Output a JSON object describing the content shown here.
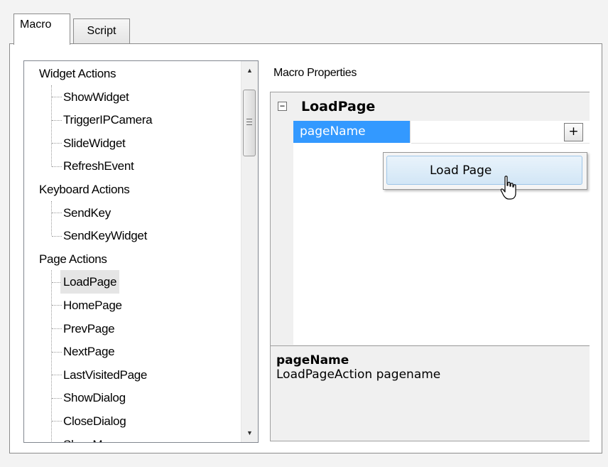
{
  "tabs": [
    {
      "label": "Macro",
      "active": true
    },
    {
      "label": "Script",
      "active": false
    }
  ],
  "action_tree": {
    "categories": [
      {
        "label": "Widget Actions",
        "children": [
          "ShowWidget",
          "TriggerIPCamera",
          "SlideWidget",
          "RefreshEvent"
        ]
      },
      {
        "label": "Keyboard Actions",
        "children": [
          "SendKey",
          "SendKeyWidget"
        ]
      },
      {
        "label": "Page Actions",
        "children": [
          "LoadPage",
          "HomePage",
          "PrevPage",
          "NextPage",
          "LastVisitedPage",
          "ShowDialog",
          "CloseDialog",
          "ShowMessage"
        ]
      }
    ],
    "selected": "LoadPage",
    "scroll": {
      "up_glyph": "▲",
      "down_glyph": "▼"
    }
  },
  "macro_properties": {
    "label": "Macro Properties",
    "collapse_glyph": "−",
    "category": "LoadPage",
    "property": {
      "name": "pageName",
      "value": ""
    },
    "dropdown_button": "+",
    "help": {
      "title": "pageName",
      "description": "LoadPageAction pagename"
    }
  },
  "dropdown_menu": {
    "items": [
      "Load Page"
    ]
  },
  "colors": {
    "selection": "#3399ff",
    "hover_item": "#d2e6f6",
    "tree_selected": "#e5e5e5"
  },
  "icons": {
    "cursor": "pointer-cursor-icon",
    "collapse": "collapse-minus-icon",
    "scroll_up": "scroll-up-arrow-icon",
    "scroll_down": "scroll-down-arrow-icon"
  }
}
